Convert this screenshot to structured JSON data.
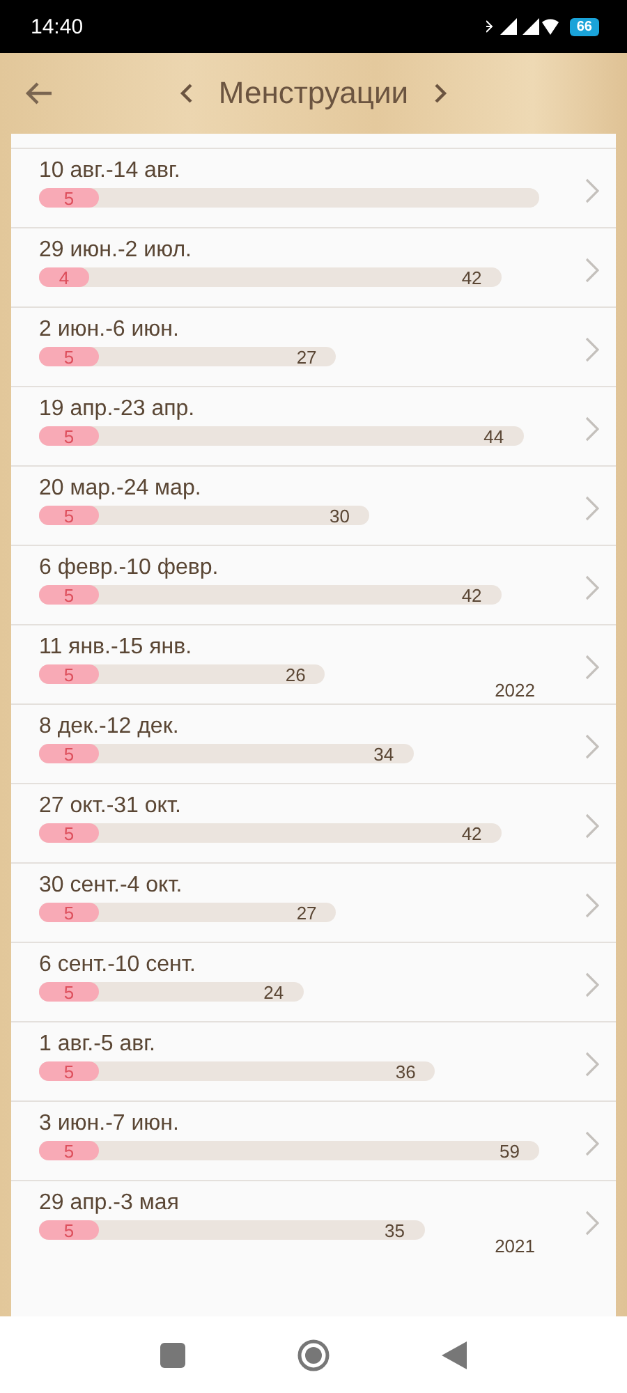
{
  "status_bar": {
    "time": "14:40",
    "battery": "66"
  },
  "header": {
    "title": "Менструации"
  },
  "rows": [
    {
      "dates": "10 авг.-14 авг.",
      "period": {
        "days": "5",
        "level": 0.12
      }
    },
    {
      "dates": "29 июн.-2 июл.",
      "period": {
        "days": "4",
        "level": 0.1
      },
      "cycle": {
        "days": "42"
      }
    },
    {
      "dates": "2 июн.-6 июн.",
      "period": {
        "days": "5",
        "level": 0.12
      },
      "cycle": {
        "days": "27"
      }
    },
    {
      "dates": "19 апр.-23 апр.",
      "period": {
        "days": "5",
        "level": 0.12
      },
      "cycle": {
        "days": "44"
      }
    },
    {
      "dates": "20 мар.-24 мар.",
      "period": {
        "days": "5",
        "level": 0.12
      },
      "cycle": {
        "days": "30"
      }
    },
    {
      "dates": "6 февр.-10 февр.",
      "period": {
        "days": "5",
        "level": 0.12
      },
      "cycle": {
        "days": "42"
      }
    },
    {
      "dates": "11 янв.-15 янв.",
      "period": {
        "days": "5",
        "level": 0.12
      },
      "cycle": {
        "days": "26"
      },
      "year": "2022"
    },
    {
      "dates": "8 дек.-12 дек.",
      "period": {
        "days": "5",
        "level": 0.12
      },
      "cycle": {
        "days": "34"
      }
    },
    {
      "dates": "27 окт.-31 окт.",
      "period": {
        "days": "5",
        "level": 0.12
      },
      "cycle": {
        "days": "42"
      }
    },
    {
      "dates": "30 сент.-4 окт.",
      "period": {
        "days": "5",
        "level": 0.12
      },
      "cycle": {
        "days": "27"
      }
    },
    {
      "dates": "6 сент.-10 сент.",
      "period": {
        "days": "5",
        "level": 0.12
      },
      "cycle": {
        "days": "24"
      }
    },
    {
      "dates": "1 авг.-5 авг.",
      "period": {
        "days": "5",
        "level": 0.12
      },
      "cycle": {
        "days": "36"
      }
    },
    {
      "dates": "3 июн.-7 июн.",
      "period": {
        "days": "5",
        "level": 0.12
      },
      "cycle": {
        "days": "59"
      }
    },
    {
      "dates": "29 апр.-3 мая",
      "period": {
        "days": "5",
        "level": 0.12
      },
      "cycle": {
        "days": "35"
      },
      "year": "2021"
    }
  ]
}
